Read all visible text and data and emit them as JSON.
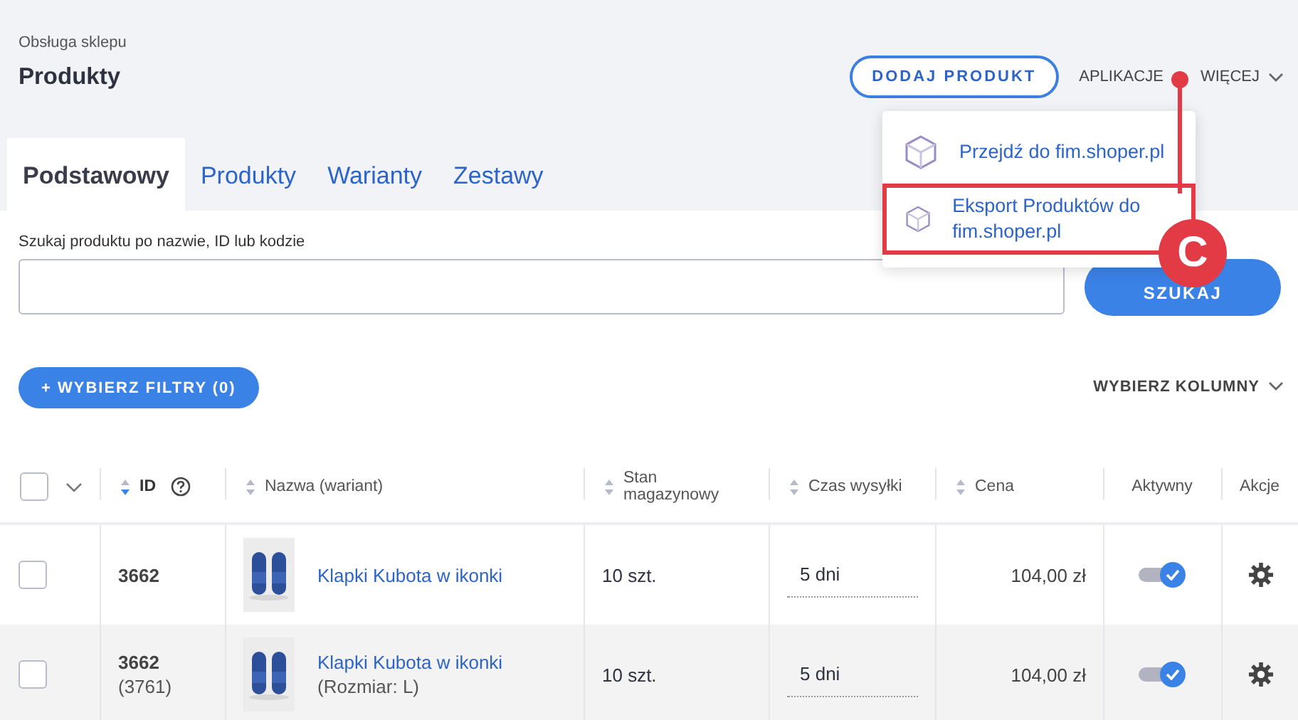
{
  "header": {
    "breadcrumb": "Obsługa sklepu",
    "title": "Produkty",
    "add_button": "DODAJ PRODUKT",
    "apps_link": "APLIKACJE",
    "more_link": "WIĘCEJ"
  },
  "tabs": [
    {
      "label": "Podstawowy",
      "selected": true
    },
    {
      "label": "Produkty",
      "selected": false
    },
    {
      "label": "Warianty",
      "selected": false
    },
    {
      "label": "Zestawy",
      "selected": false
    }
  ],
  "apps_menu": {
    "items": [
      {
        "label": "Przejdź do fim.shoper.pl",
        "highlighted": false
      },
      {
        "label": "Eksport Produktów do fim.shoper.pl",
        "highlighted": true
      }
    ]
  },
  "annotation": {
    "label": "C"
  },
  "search": {
    "label": "Szukaj produktu po nazwie, ID lub kodzie",
    "button": "SZUKAJ"
  },
  "filters_button": "+ WYBIERZ FILTRY (0)",
  "columns_link": "WYBIERZ KOLUMNY",
  "table": {
    "columns": [
      {
        "kind": "select",
        "checked": false
      },
      {
        "kind": "sort",
        "label": "ID",
        "sorted": true,
        "help": true
      },
      {
        "kind": "sort",
        "label": "Nazwa (wariant)",
        "sorted": false,
        "help": false
      },
      {
        "kind": "sort",
        "label": "Stan magazynowy",
        "sorted": false,
        "help": false
      },
      {
        "kind": "sort",
        "label": "Czas wysyłki",
        "sorted": false,
        "help": false
      },
      {
        "kind": "sort",
        "label": "Cena",
        "sorted": false,
        "help": false
      },
      {
        "kind": "plain",
        "label": "Aktywny"
      },
      {
        "kind": "plain",
        "label": "Akcje"
      }
    ],
    "rows": [
      {
        "checked": false,
        "highlighted": false,
        "id": "3662",
        "name": "Klapki Kubota w ikonki",
        "stock": "10 szt.",
        "shipping": "5 dni",
        "price": "104,00 zł",
        "active": true
      },
      {
        "checked": false,
        "highlighted": true,
        "id": "3662",
        "variant_id": "(3761)",
        "name": "Klapki Kubota w ikonki",
        "variant": "(Rozmiar: L)",
        "stock": "10 szt.",
        "shipping": "5 dni",
        "price": "104,00 zł",
        "active": true
      }
    ]
  }
}
